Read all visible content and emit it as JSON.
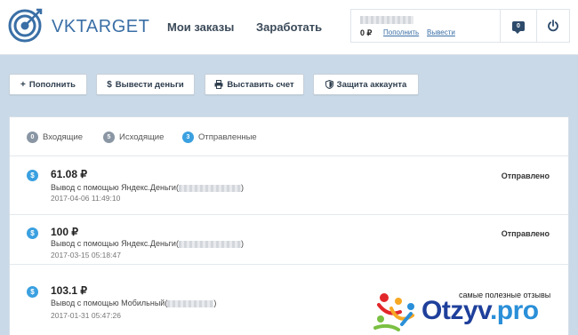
{
  "header": {
    "logo_text": "VKTARGET",
    "nav": {
      "orders": "Мои заказы",
      "earn": "Заработать"
    },
    "balance": {
      "amount": "0 ₽",
      "topup_link": "Пополнить",
      "withdraw_link": "Вывести"
    },
    "messages_count": "0"
  },
  "actions": {
    "topup": "Пополнить",
    "withdraw": "Вывести деньги",
    "invoice": "Выставить счет",
    "protect": "Защита аккаунта"
  },
  "tabs": [
    {
      "label": "Входящие",
      "count": "0"
    },
    {
      "label": "Исходящие",
      "count": "5"
    },
    {
      "label": "Отправленные",
      "count": "3"
    }
  ],
  "transactions": [
    {
      "amount": "61.08 ₽",
      "desc_prefix": "Вывод с помощью Яндекс.Деньги(",
      "desc_suffix": ")",
      "date": "2017-04-06 11:49:10",
      "status": "Отправлено"
    },
    {
      "amount": "100 ₽",
      "desc_prefix": "Вывод с помощью Яндекс.Деньги(",
      "desc_suffix": ")",
      "date": "2017-03-15 05:18:47",
      "status": "Отправлено"
    },
    {
      "amount": "103.1 ₽",
      "desc_prefix": "Вывод с помощью Мобильный(",
      "desc_suffix": ")",
      "date": "2017-01-31 05:47:26",
      "status": ""
    }
  ],
  "watermark": {
    "tagline": "самые полезные отзывы",
    "brand_main": "Otzyv",
    "brand_tld": ".pro"
  },
  "colors": {
    "accent": "#3aa0e0",
    "brand": "#3a6fa6",
    "background": "#c9d9e8"
  }
}
